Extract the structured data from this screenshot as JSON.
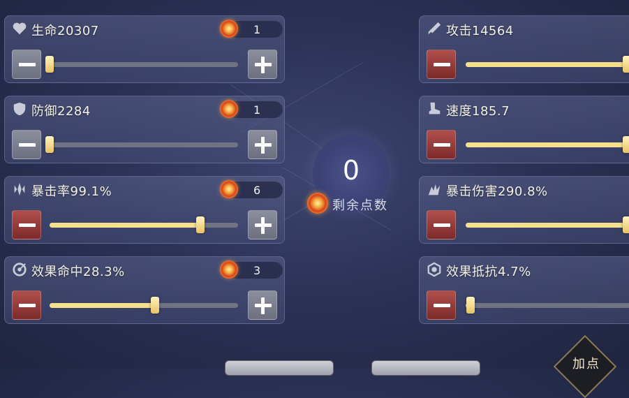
{
  "remaining_points": {
    "value": "0",
    "label": "剩余点数",
    "icon": "coin-icon"
  },
  "left_stats": [
    {
      "key": "hp",
      "icon": "heart-icon",
      "label": "生命20307",
      "points": "1",
      "level": 0.0,
      "minus_active": false
    },
    {
      "key": "def",
      "icon": "shield-icon",
      "label": "防御2284",
      "points": "1",
      "level": 0.0,
      "minus_active": false
    },
    {
      "key": "crit",
      "icon": "crit-rate-icon",
      "label": "暴击率99.1%",
      "points": "6",
      "level": 0.8,
      "minus_active": true
    },
    {
      "key": "acc",
      "icon": "accuracy-icon",
      "label": "效果命中28.3%",
      "points": "3",
      "level": 0.56,
      "minus_active": true
    }
  ],
  "right_stats": [
    {
      "key": "atk",
      "icon": "sword-icon",
      "label": "攻击14564",
      "level": 0.98,
      "minus_active": true
    },
    {
      "key": "spd",
      "icon": "boot-icon",
      "label": "速度185.7",
      "level": 0.98,
      "minus_active": true
    },
    {
      "key": "critdmg",
      "icon": "crit-damage-icon",
      "label": "暴击伤害290.8%",
      "level": 0.98,
      "minus_active": true
    },
    {
      "key": "res",
      "icon": "resist-icon",
      "label": "效果抵抗4.7%",
      "level": 0.03,
      "minus_active": true
    }
  ],
  "corner_button": {
    "label": "加点"
  },
  "colors": {
    "slider_fill": "#f6e08e",
    "minus_red": "#9a3c38",
    "minus_grey": "#7d808f",
    "background": "#2c3256"
  }
}
